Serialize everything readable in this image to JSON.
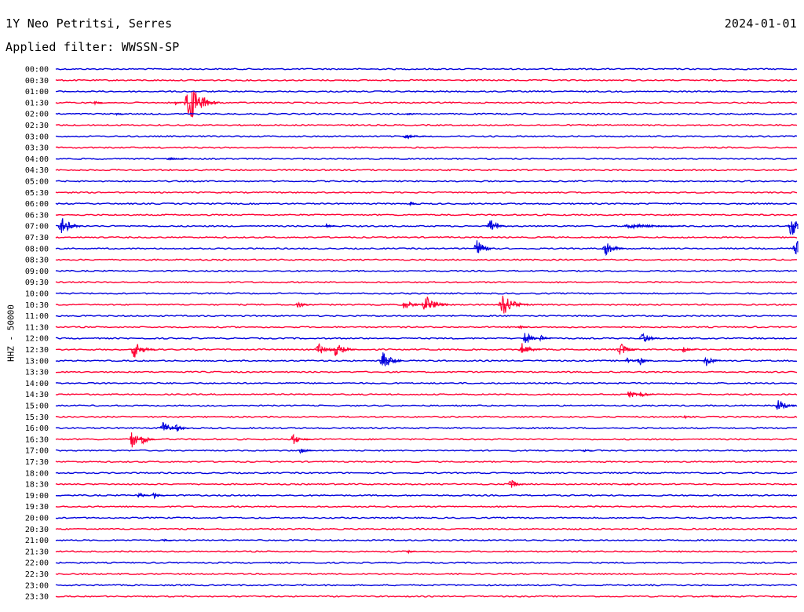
{
  "header": {
    "station": "1Y Neo Petritsi, Serres",
    "date": "2024-01-01",
    "filter_label": "Applied filter: WWSSN-SP"
  },
  "colors": {
    "even": "#0000dd",
    "odd": "#ff0033"
  },
  "chart_data": {
    "type": "line",
    "ylabel": "HHZ - 50000",
    "x_unit": "minutes",
    "xlim": [
      0,
      30
    ],
    "row_labels": [
      "00:00",
      "00:30",
      "01:00",
      "01:30",
      "02:00",
      "02:30",
      "03:00",
      "03:30",
      "04:00",
      "04:30",
      "05:00",
      "05:30",
      "06:00",
      "06:30",
      "07:00",
      "07:30",
      "08:00",
      "08:30",
      "09:00",
      "09:30",
      "10:00",
      "10:30",
      "11:00",
      "11:30",
      "12:00",
      "12:30",
      "13:00",
      "13:30",
      "14:00",
      "14:30",
      "15:00",
      "15:30",
      "16:00",
      "16:30",
      "17:00",
      "17:30",
      "18:00",
      "18:30",
      "19:00",
      "19:30",
      "20:00",
      "20:30",
      "21:00",
      "21:30",
      "22:00",
      "22:30",
      "23:00",
      "23:30"
    ],
    "events": [
      {
        "row": 3,
        "t": 1.5,
        "amp": 0.6,
        "dur": 0.4
      },
      {
        "row": 3,
        "t": 4.8,
        "amp": 0.5,
        "dur": 0.3
      },
      {
        "row": 3,
        "t": 5.2,
        "amp": 4.5,
        "dur": 1.4
      },
      {
        "row": 4,
        "t": 2.4,
        "amp": 0.3,
        "dur": 0.5
      },
      {
        "row": 4,
        "t": 14.2,
        "amp": 0.3,
        "dur": 0.3
      },
      {
        "row": 6,
        "t": 14.0,
        "amp": 0.5,
        "dur": 1.2
      },
      {
        "row": 8,
        "t": 4.5,
        "amp": 0.4,
        "dur": 0.8
      },
      {
        "row": 12,
        "t": 14.3,
        "amp": 0.6,
        "dur": 0.3
      },
      {
        "row": 14,
        "t": 0.1,
        "amp": 2.2,
        "dur": 1.0
      },
      {
        "row": 14,
        "t": 10.9,
        "amp": 0.8,
        "dur": 0.4
      },
      {
        "row": 14,
        "t": 17.4,
        "amp": 2.2,
        "dur": 0.8
      },
      {
        "row": 14,
        "t": 22.9,
        "amp": 0.6,
        "dur": 2.5
      },
      {
        "row": 14,
        "t": 29.6,
        "amp": 2.4,
        "dur": 1.0
      },
      {
        "row": 16,
        "t": 16.9,
        "amp": 2.2,
        "dur": 0.8
      },
      {
        "row": 16,
        "t": 22.1,
        "amp": 1.6,
        "dur": 0.9
      },
      {
        "row": 16,
        "t": 29.8,
        "amp": 2.6,
        "dur": 1.0
      },
      {
        "row": 21,
        "t": 9.7,
        "amp": 1.0,
        "dur": 0.6
      },
      {
        "row": 21,
        "t": 14.0,
        "amp": 1.4,
        "dur": 0.8
      },
      {
        "row": 21,
        "t": 14.8,
        "amp": 2.4,
        "dur": 1.1
      },
      {
        "row": 21,
        "t": 17.9,
        "amp": 2.6,
        "dur": 1.2
      },
      {
        "row": 23,
        "t": 18.7,
        "amp": 0.5,
        "dur": 0.4
      },
      {
        "row": 24,
        "t": 18.9,
        "amp": 1.8,
        "dur": 0.6
      },
      {
        "row": 24,
        "t": 19.5,
        "amp": 1.2,
        "dur": 0.6
      },
      {
        "row": 24,
        "t": 23.6,
        "amp": 1.5,
        "dur": 0.8
      },
      {
        "row": 25,
        "t": 3.0,
        "amp": 2.2,
        "dur": 1.0
      },
      {
        "row": 25,
        "t": 10.5,
        "amp": 1.6,
        "dur": 0.9
      },
      {
        "row": 25,
        "t": 11.2,
        "amp": 1.8,
        "dur": 0.9
      },
      {
        "row": 25,
        "t": 18.7,
        "amp": 1.6,
        "dur": 0.9
      },
      {
        "row": 25,
        "t": 22.7,
        "amp": 1.6,
        "dur": 0.8
      },
      {
        "row": 25,
        "t": 25.3,
        "amp": 0.8,
        "dur": 0.6
      },
      {
        "row": 26,
        "t": 13.1,
        "amp": 2.3,
        "dur": 0.9
      },
      {
        "row": 26,
        "t": 23.0,
        "amp": 0.9,
        "dur": 0.5
      },
      {
        "row": 26,
        "t": 23.5,
        "amp": 1.1,
        "dur": 0.6
      },
      {
        "row": 26,
        "t": 26.2,
        "amp": 1.4,
        "dur": 0.7
      },
      {
        "row": 29,
        "t": 23.1,
        "amp": 1.2,
        "dur": 0.6
      },
      {
        "row": 29,
        "t": 23.6,
        "amp": 1.0,
        "dur": 0.6
      },
      {
        "row": 30,
        "t": 29.1,
        "amp": 1.5,
        "dur": 0.8
      },
      {
        "row": 31,
        "t": 25.4,
        "amp": 0.4,
        "dur": 0.3
      },
      {
        "row": 32,
        "t": 4.2,
        "amp": 2.0,
        "dur": 0.8
      },
      {
        "row": 32,
        "t": 4.8,
        "amp": 1.0,
        "dur": 0.6
      },
      {
        "row": 33,
        "t": 3.0,
        "amp": 2.2,
        "dur": 0.6
      },
      {
        "row": 33,
        "t": 3.4,
        "amp": 1.6,
        "dur": 0.6
      },
      {
        "row": 33,
        "t": 9.5,
        "amp": 1.3,
        "dur": 0.8
      },
      {
        "row": 34,
        "t": 9.8,
        "amp": 0.7,
        "dur": 0.7
      },
      {
        "row": 34,
        "t": 21.3,
        "amp": 0.3,
        "dur": 0.4
      },
      {
        "row": 37,
        "t": 18.3,
        "amp": 1.4,
        "dur": 0.6
      },
      {
        "row": 37,
        "t": 23.0,
        "amp": 0.3,
        "dur": 0.3
      },
      {
        "row": 38,
        "t": 3.3,
        "amp": 0.8,
        "dur": 0.5
      },
      {
        "row": 38,
        "t": 3.9,
        "amp": 0.8,
        "dur": 0.5
      },
      {
        "row": 42,
        "t": 4.3,
        "amp": 0.3,
        "dur": 0.5
      },
      {
        "row": 43,
        "t": 14.2,
        "amp": 0.4,
        "dur": 0.4
      },
      {
        "row": 47,
        "t": 26.5,
        "amp": 0.2,
        "dur": 0.3
      }
    ]
  }
}
